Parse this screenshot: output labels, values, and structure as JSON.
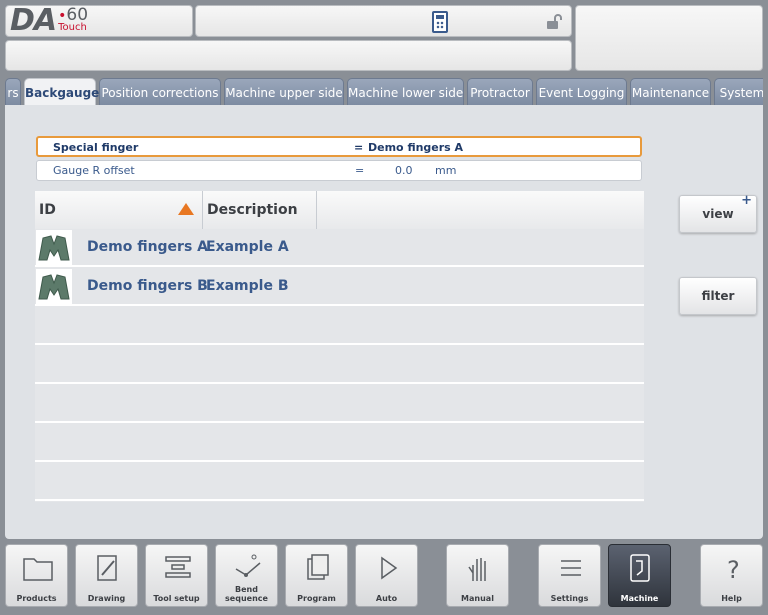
{
  "logo": {
    "brand": "DA",
    "model": "60",
    "edition": "Touch"
  },
  "tabs": [
    "rs",
    "Backgauge",
    "Position corrections",
    "Machine upper side",
    "Machine lower side",
    "Protractor",
    "Event Logging",
    "Maintenance",
    "System"
  ],
  "params": [
    {
      "label": "Special finger",
      "eq": "=",
      "value": "Demo fingers A",
      "unit": ""
    },
    {
      "label": "Gauge R offset",
      "eq": "=",
      "value": "0.0",
      "unit": "mm"
    }
  ],
  "table": {
    "headers": [
      "ID",
      "Description"
    ],
    "rows": [
      {
        "id": "Demo fingers A",
        "description": "Example A"
      },
      {
        "id": "Demo fingers B",
        "description": "Example B"
      }
    ]
  },
  "side_buttons": {
    "view": "view",
    "view_badge": "+",
    "filter": "filter"
  },
  "nav": [
    "Products",
    "Drawing",
    "Tool setup",
    "Bend sequence",
    "Program",
    "Auto",
    "Manual",
    "Settings",
    "Machine",
    "Help"
  ],
  "accent_color": "#e87722"
}
